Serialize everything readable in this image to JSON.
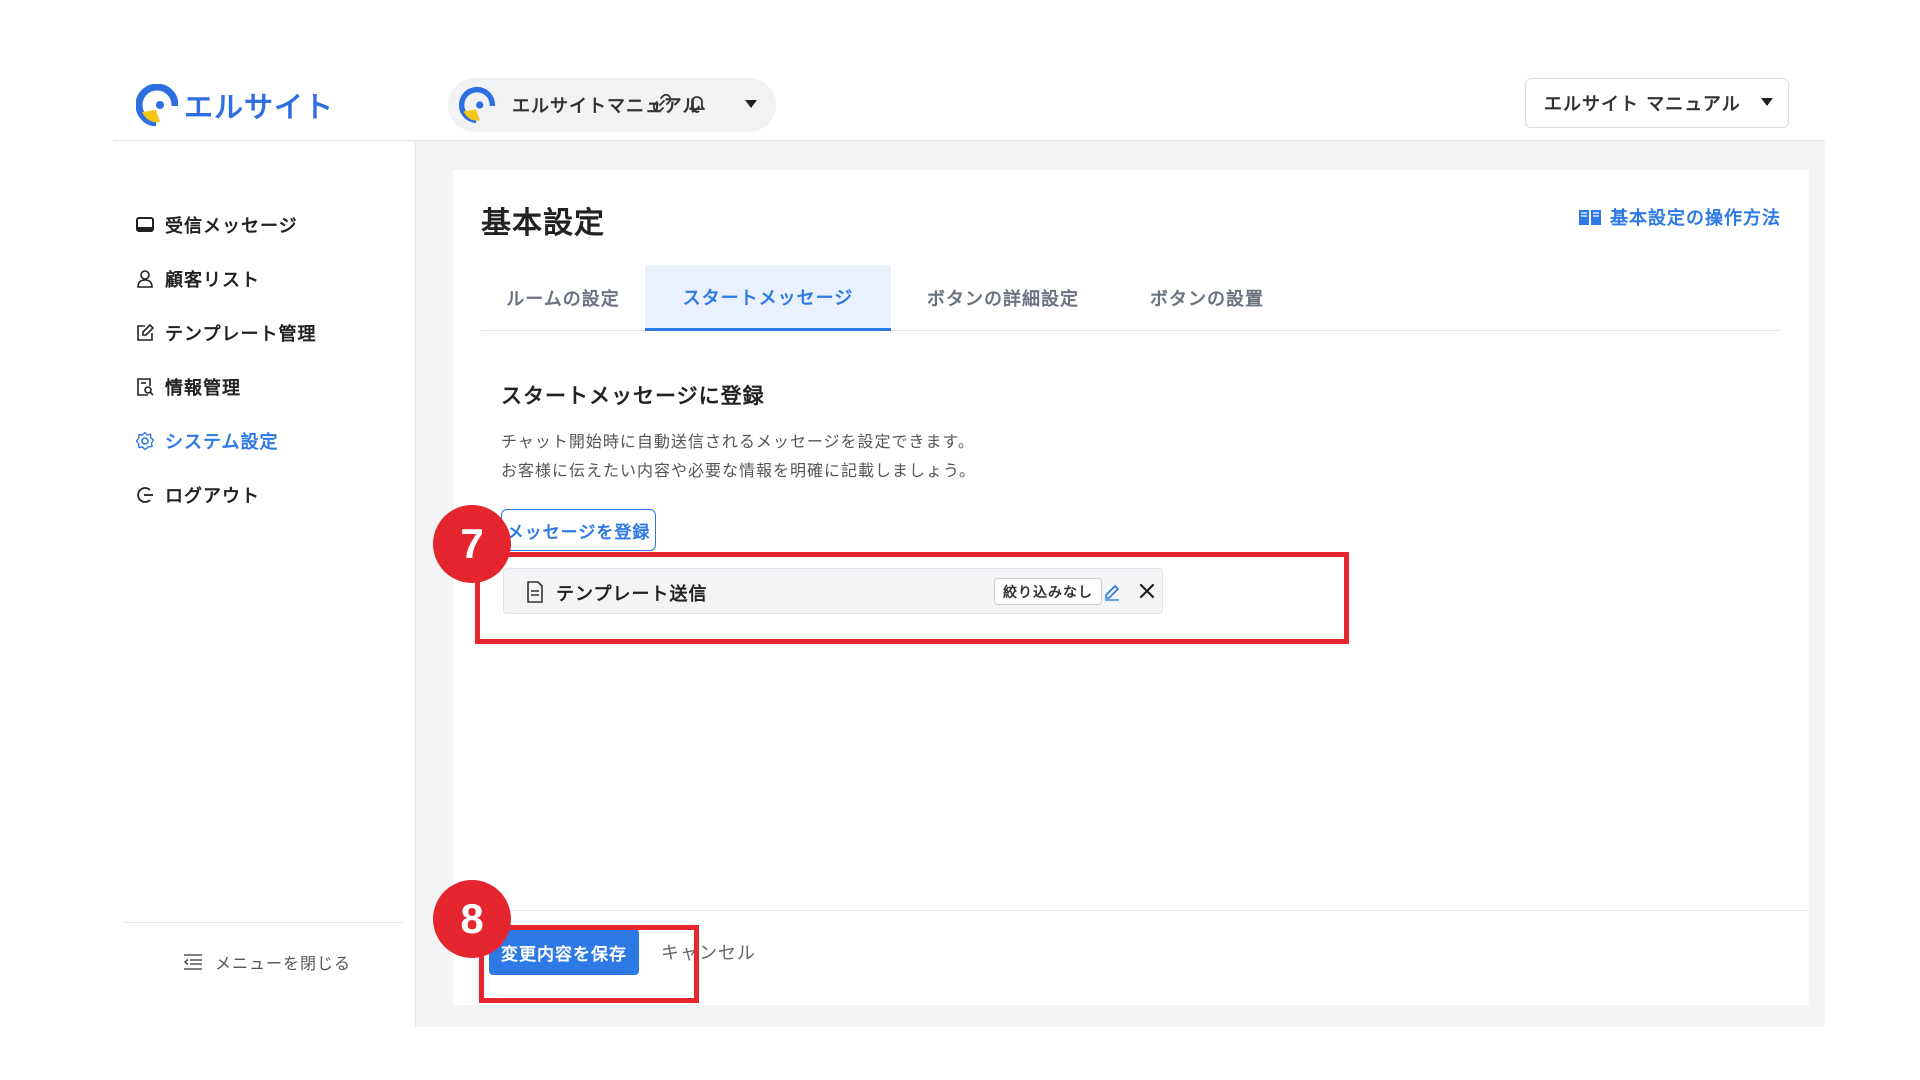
{
  "brand": {
    "name": "エルサイト"
  },
  "header": {
    "workspace_name": "エルサイトマニュアル",
    "user_select_value": "エルサイト マニュアル",
    "icons": [
      "link-icon",
      "bell-icon"
    ]
  },
  "sidebar": {
    "items": [
      {
        "label": "受信メッセージ",
        "icon": "inbox-icon",
        "active": false
      },
      {
        "label": "顧客リスト",
        "icon": "user-icon",
        "active": false
      },
      {
        "label": "テンプレート管理",
        "icon": "edit-icon",
        "active": false
      },
      {
        "label": "情報管理",
        "icon": "document-search-icon",
        "active": false
      },
      {
        "label": "システム設定",
        "icon": "gear-icon",
        "active": true
      },
      {
        "label": "ログアウト",
        "icon": "logout-icon",
        "active": false
      }
    ],
    "close_menu_label": "メニューを閉じる"
  },
  "page": {
    "title": "基本設定",
    "help_link": "基本設定の操作方法",
    "tabs": [
      {
        "label": "ルームの設定",
        "active": false
      },
      {
        "label": "スタートメッセージ",
        "active": true
      },
      {
        "label": "ボタンの詳細設定",
        "active": false
      },
      {
        "label": "ボタンの設置",
        "active": false
      }
    ],
    "section_title": "スタートメッセージに登録",
    "description_lines": [
      "チャット開始時に自動送信されるメッセージを設定できます。",
      "お客様に伝えたい内容や必要な情報を明確に記載しましょう。"
    ],
    "register_button": "メッセージを登録",
    "message_item": {
      "label": "テンプレート送信",
      "filter_badge": "絞り込みなし"
    },
    "save_button": "変更内容を保存",
    "cancel_button": "キャンセル"
  },
  "annotations": {
    "step_7": "7",
    "step_8": "8",
    "color": "#e5262f"
  },
  "colors": {
    "accent": "#2d79e6",
    "tab_active_bg": "#e8f1fd",
    "logo_yellow": "#f5c518"
  }
}
